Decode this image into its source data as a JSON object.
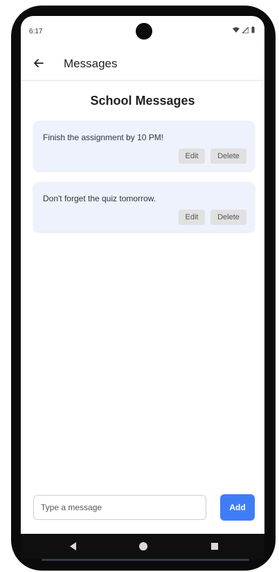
{
  "status_bar": {
    "time": "6:17",
    "icons": [
      "wifi-icon",
      "signal-icon",
      "battery-icon"
    ]
  },
  "app_bar": {
    "back_icon": "arrow-left-icon",
    "title": "Messages"
  },
  "page": {
    "title": "School Messages"
  },
  "messages": [
    {
      "text": "Finish the assignment by 10 PM!",
      "edit_label": "Edit",
      "delete_label": "Delete"
    },
    {
      "text": "Don't forget the quiz tomorrow.",
      "edit_label": "Edit",
      "delete_label": "Delete"
    }
  ],
  "composer": {
    "placeholder": "Type a message",
    "value": "",
    "add_label": "Add"
  },
  "nav_bar": {
    "buttons": [
      "back-triangle-icon",
      "home-circle-icon",
      "recents-square-icon"
    ]
  },
  "colors": {
    "accent": "#3f7df7",
    "card_background": "#edf2fd",
    "button_background": "#e1e1e1"
  }
}
